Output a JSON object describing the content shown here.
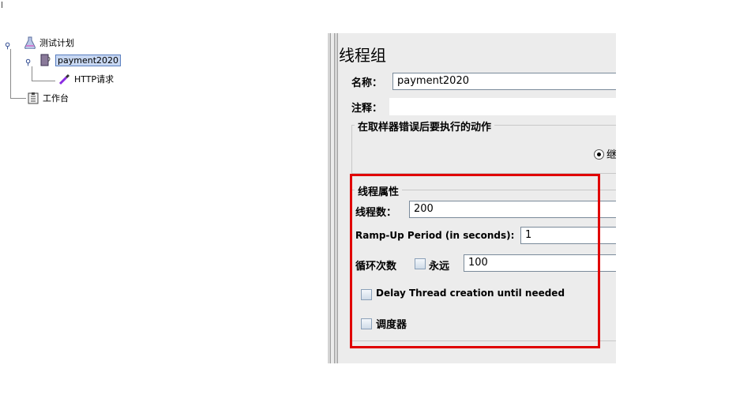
{
  "tree": {
    "items": [
      {
        "label": "测试计划",
        "icon": "flask-icon"
      },
      {
        "label": "payment2020",
        "icon": "thread-group-icon",
        "selected": true
      },
      {
        "label": "HTTP请求",
        "icon": "pipette-icon"
      },
      {
        "label": "工作台",
        "icon": "clipboard-icon"
      }
    ]
  },
  "panel": {
    "title": "线程组",
    "name_label": "名称：",
    "name_value": "payment2020",
    "comment_label": "注释：",
    "comment_value": "",
    "on_error": {
      "title": "在取样器错误后要执行的动作",
      "selected_option_partial": "继"
    },
    "thread_props": {
      "title": "线程属性",
      "threads_label": "线程数：",
      "threads_value": "200",
      "rampup_label": "Ramp-Up Period (in seconds):",
      "rampup_value": "1",
      "loop_label": "循环次数",
      "forever_label": "永远",
      "loop_value": "100",
      "delay_label": "Delay Thread creation until needed",
      "scheduler_label": "调度器"
    }
  },
  "colors": {
    "highlight_box": "#e00000",
    "selection": "#c7d7f2",
    "panel_bg": "#ececec"
  }
}
